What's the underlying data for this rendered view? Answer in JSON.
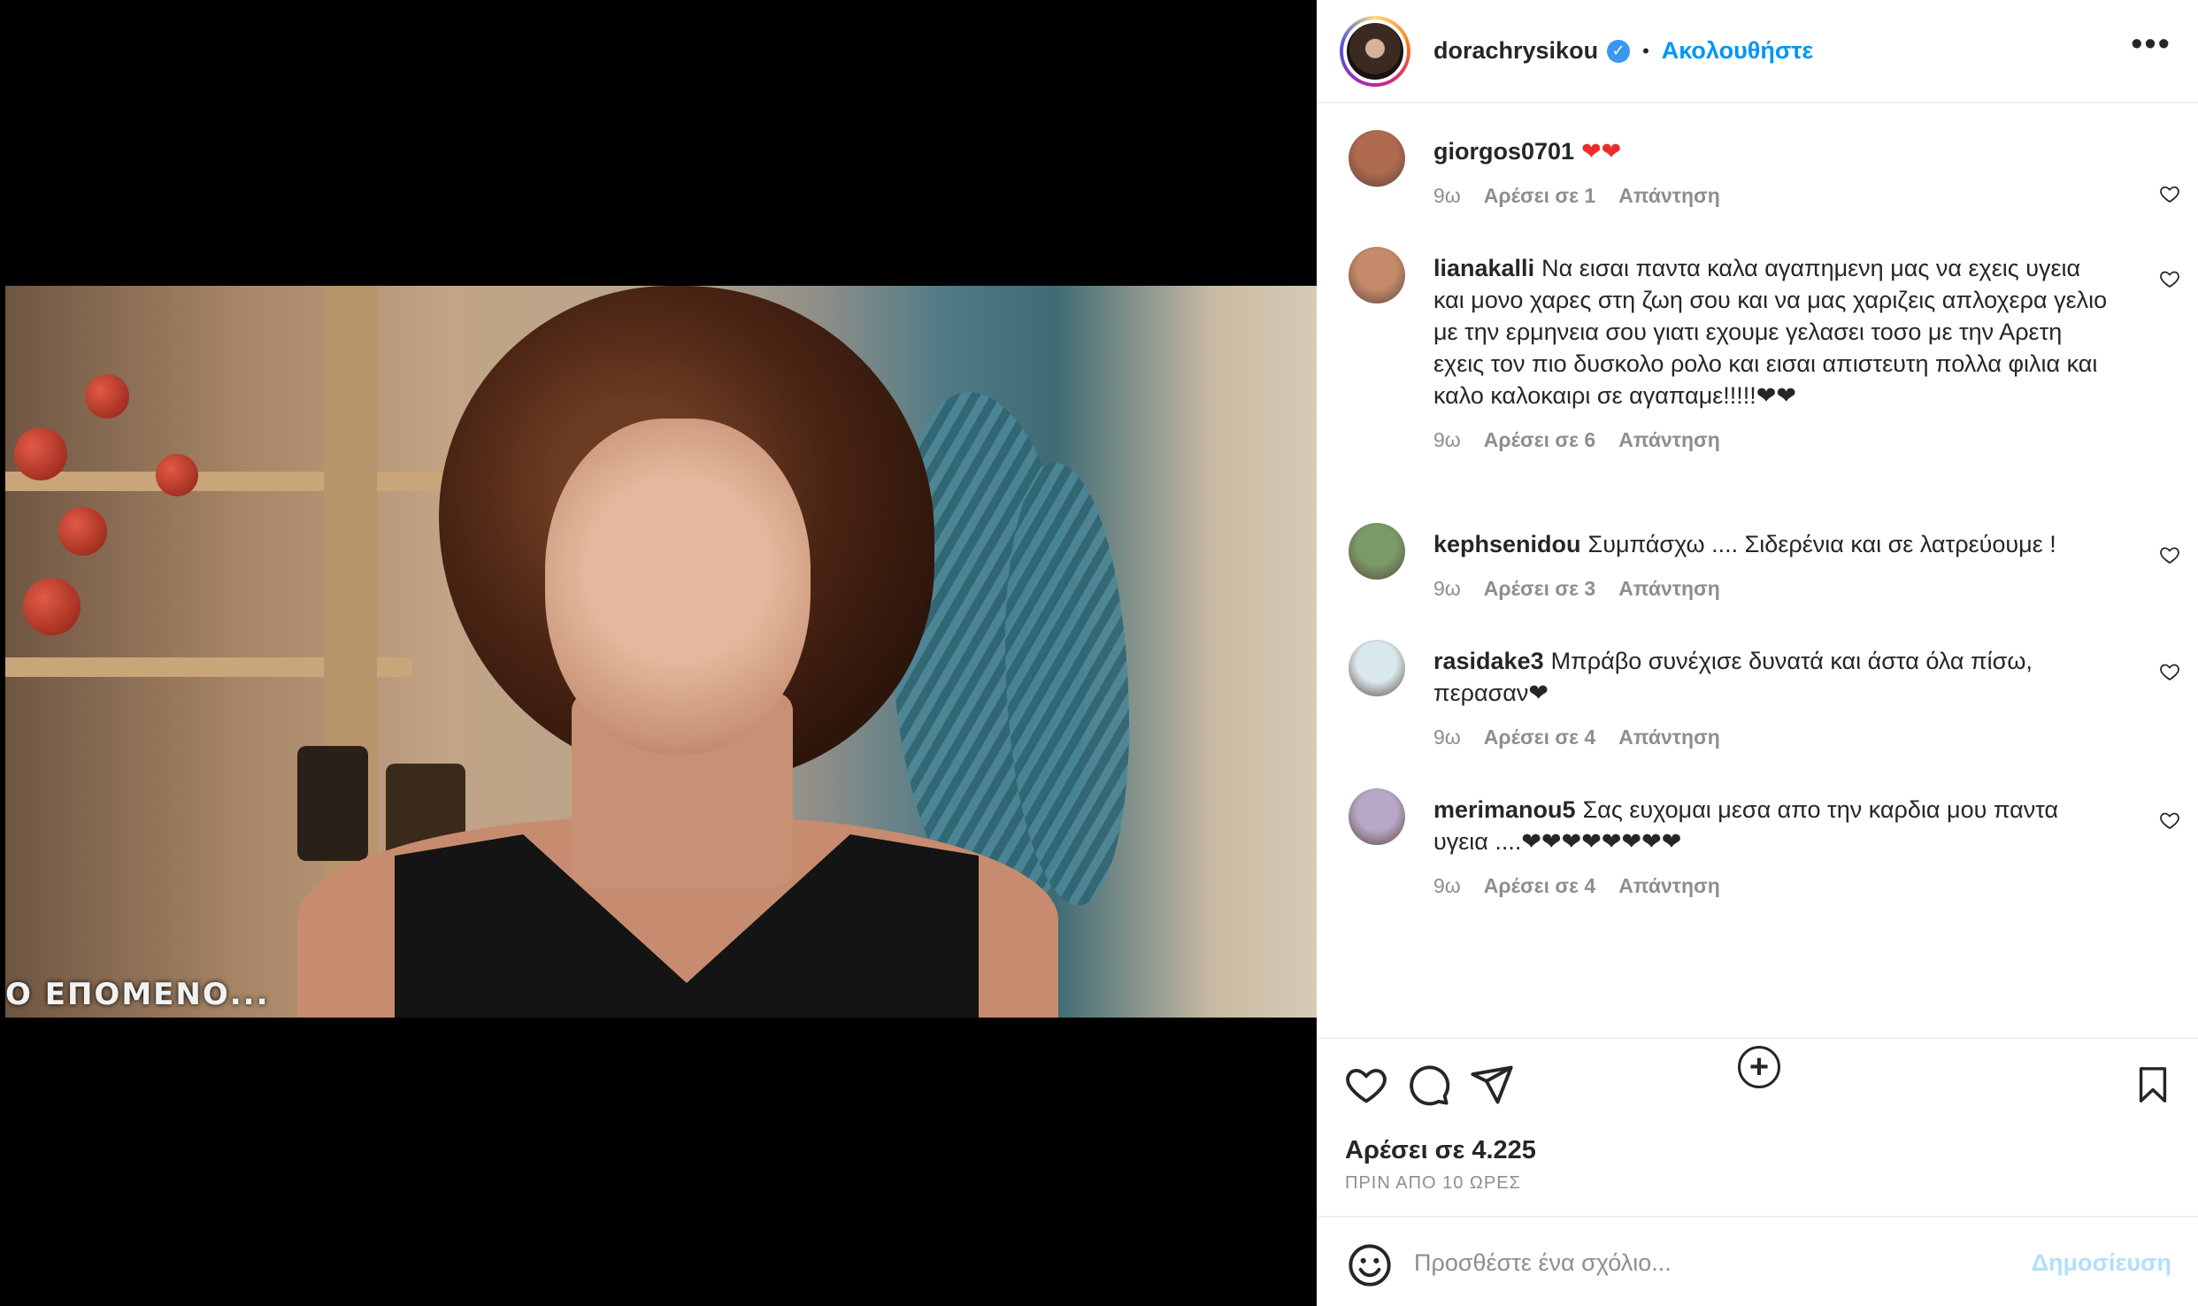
{
  "media": {
    "subtitle": "Ο ΕΠΟΜΕΝΟ..."
  },
  "header": {
    "username": "dorachrysikou",
    "verified_glyph": "✓",
    "separator": "•",
    "follow_label": "Ακολουθήστε",
    "more_glyph": "•••"
  },
  "comments": [
    {
      "username": "giorgos0701",
      "text": "❤❤",
      "time": "9ω",
      "likes": "Αρέσει σε 1",
      "reply": "Απάντηση",
      "avatar_color": "#b06a50"
    },
    {
      "username": "lianakalli",
      "text": "Να εισαι παντα καλα αγαπημενη μας να εχεις υγεια και μονο χαρες στη ζωη σου και να μας χαριζεις απλοχερα γελιο με την ερμηνεια σου γιατι εχουμε γελασει τοσο με την Αρετη εχεις τον πιο δυσκολο ρολο και εισαι απιστευτη πολλα φιλια και καλο καλοκαιρι σε αγαπαμε!!!!!❤❤",
      "time": "9ω",
      "likes": "Αρέσει σε 6",
      "reply": "Απάντηση",
      "avatar_color": "#c48a6a"
    },
    {
      "username": "kephsenidou",
      "text": "Συμπάσχω .... Σιδερένια και σε λατρεύουμε !",
      "time": "9ω",
      "likes": "Αρέσει σε 3",
      "reply": "Απάντηση",
      "avatar_color": "#7a9a6a"
    },
    {
      "username": "rasidake3",
      "text": "Μπράβο συνέχισε δυνατά και άστα όλα πίσω, περασαν❤",
      "time": "9ω",
      "likes": "Αρέσει σε 4",
      "reply": "Απάντηση",
      "avatar_color": "#d9e8ec"
    },
    {
      "username": "merimanou5",
      "text": "Σας ευχομαι μεσα απο την καρδια μου παντα υγεια ....❤❤❤❤❤❤❤❤",
      "time": "9ω",
      "likes": "Αρέσει σε 4",
      "reply": "Απάντηση",
      "avatar_color": "#b8a8c8"
    }
  ],
  "load_more_glyph": "+",
  "actions": {
    "likes_count": "Αρέσει σε 4.225",
    "posted_time": "ΠΡΙΝ ΑΠΟ 10 ΩΡΕΣ"
  },
  "composer": {
    "placeholder": "Προσθέστε ένα σχόλιο...",
    "post_label": "Δημοσίευση"
  },
  "colors": {
    "accent": "#0095f6",
    "muted": "#8e8e8e",
    "heart": "#ed2b2b",
    "post_disabled": "#b2dffc"
  }
}
